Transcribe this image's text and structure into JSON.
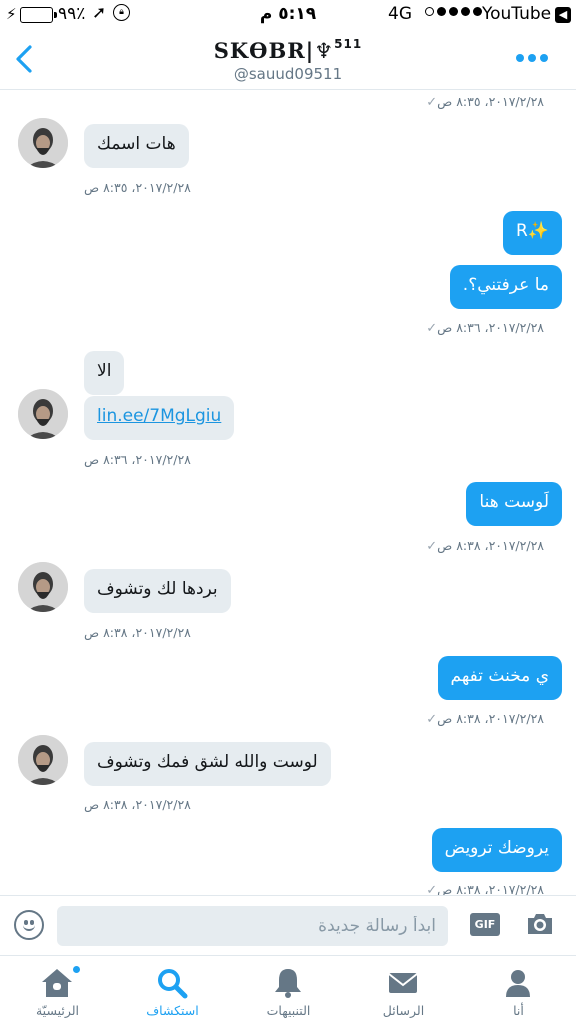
{
  "status_bar": {
    "battery_pct": "٩٩٪",
    "battery_level": 0.99,
    "time": "٥:١٩ م",
    "network": "4G",
    "back_app": "YouTube",
    "back_arrow": "◀"
  },
  "header": {
    "title": "SKϴBR|♆",
    "title_sup": "511",
    "handle": "@sauud09511"
  },
  "messages": [
    {
      "dir": "out",
      "timestamp": "٢٠١٧/٢/٢٨، ٨:٣٥ ص",
      "checkmark": "✓"
    },
    {
      "dir": "in",
      "text": "هات اسمك",
      "timestamp": "٢٠١٧/٢/٢٨، ٨:٣٥ ص"
    },
    {
      "dir": "out",
      "text": "R✨"
    },
    {
      "dir": "out",
      "text": "ما عرفتني؟.",
      "timestamp": "٢٠١٧/٢/٢٨، ٨:٣٦ ص",
      "checkmark": "✓"
    },
    {
      "dir": "in",
      "text": "الا"
    },
    {
      "dir": "in",
      "text": "lin.ee/7MgLgiu",
      "timestamp": "٢٠١٧/٢/٢٨، ٨:٣٦ ص"
    },
    {
      "dir": "out",
      "text": "لَوست هنا",
      "timestamp": "٢٠١٧/٢/٢٨، ٨:٣٨ ص",
      "checkmark": "✓"
    },
    {
      "dir": "in",
      "text": "بردها لك وتشوف",
      "timestamp": "٢٠١٧/٢/٢٨، ٨:٣٨ ص"
    },
    {
      "dir": "out",
      "text": "ي مخنث تفهم",
      "timestamp": "٢٠١٧/٢/٢٨، ٨:٣٨ ص",
      "checkmark": "✓"
    },
    {
      "dir": "in",
      "text": "لوست والله لشق فمك وتشوف",
      "timestamp": "٢٠١٧/٢/٢٨، ٨:٣٨ ص"
    },
    {
      "dir": "out",
      "text": "يروضك ترويض",
      "timestamp": "٢٠١٧/٢/٢٨، ٨:٣٨ ص",
      "checkmark": "✓"
    }
  ],
  "composer": {
    "placeholder": "ابدأ رسالة جديدة",
    "gif_label": "GIF"
  },
  "tabs": [
    {
      "label": "أنا",
      "icon": "person-icon"
    },
    {
      "label": "الرسائل",
      "icon": "envelope-icon"
    },
    {
      "label": "التنبيهات",
      "icon": "bell-icon"
    },
    {
      "label": "استكشاف",
      "icon": "search-icon",
      "active": true
    },
    {
      "label": "الرئيسيّة",
      "icon": "home-icon",
      "badge": true
    }
  ],
  "colors": {
    "accent": "#1da1f2",
    "incoming_bubble": "#e6ecf0",
    "battery": "#4cd964"
  }
}
